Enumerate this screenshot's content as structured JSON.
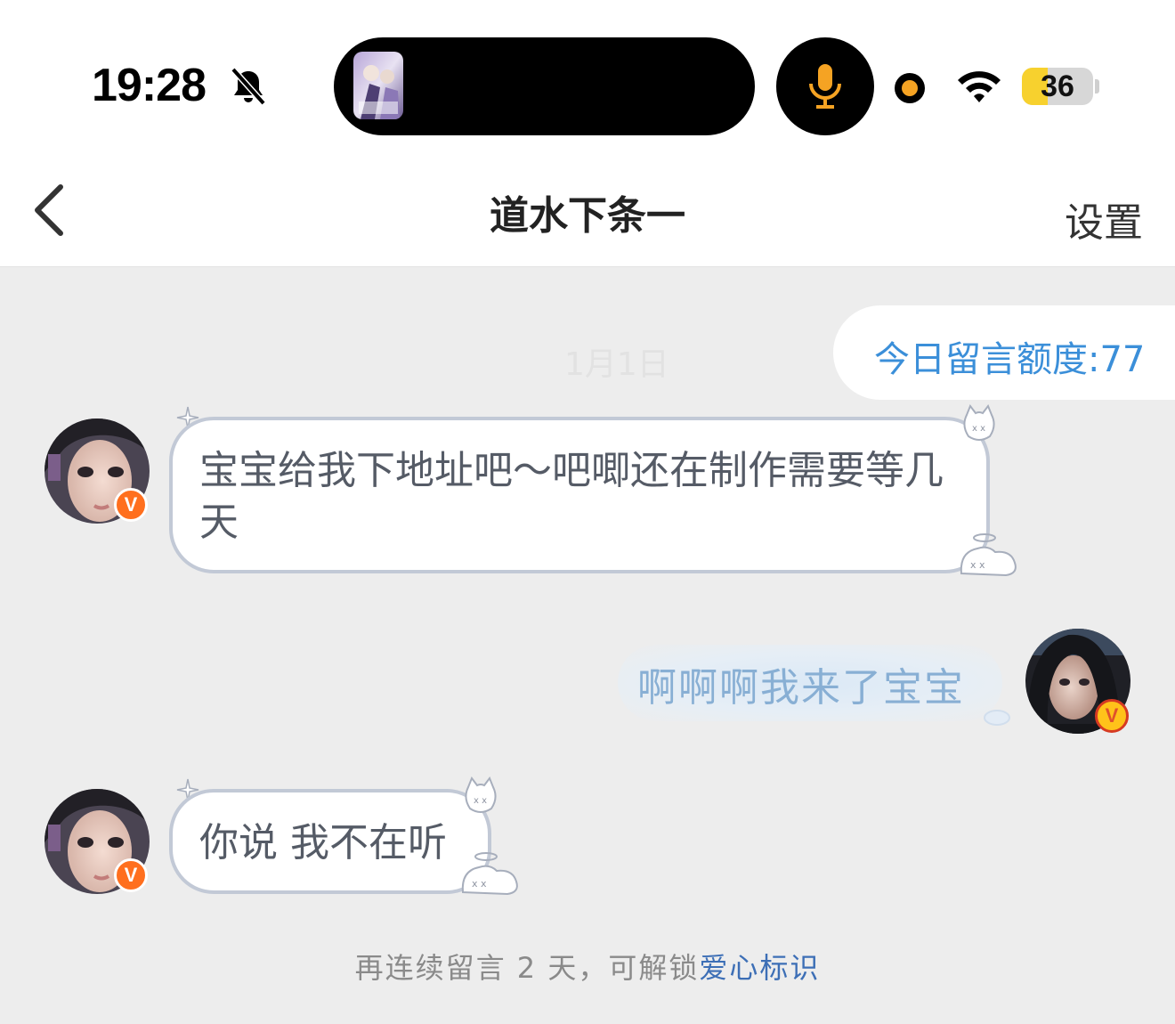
{
  "status_bar": {
    "time": "19:28",
    "battery_level": 36,
    "battery_text": "36",
    "icons": [
      "bell-off-icon",
      "mic-icon",
      "privacy-dot-icon",
      "wifi-icon",
      "battery-icon"
    ]
  },
  "nav": {
    "title": "道水下条一",
    "settings_label": "设置",
    "back_icon": "chevron-left-icon"
  },
  "quota": {
    "label": "今日留言额度:77"
  },
  "ghost_timestamp": "1月1日",
  "messages": [
    {
      "side": "left",
      "text": "宝宝给我下地址吧～吧唧还在制作需要等几天",
      "verified": "V"
    },
    {
      "side": "right",
      "text": "啊啊啊我来了宝宝",
      "verified": "V"
    },
    {
      "side": "left",
      "text": "你说 我不在听",
      "verified": "V"
    }
  ],
  "footer": {
    "prefix": "再连续留言 2 天，可解锁",
    "link": "爱心标识"
  },
  "colors": {
    "accent_blue": "#3b8fd9",
    "badge_orange": "#ff6f1e",
    "background": "#ededed"
  }
}
